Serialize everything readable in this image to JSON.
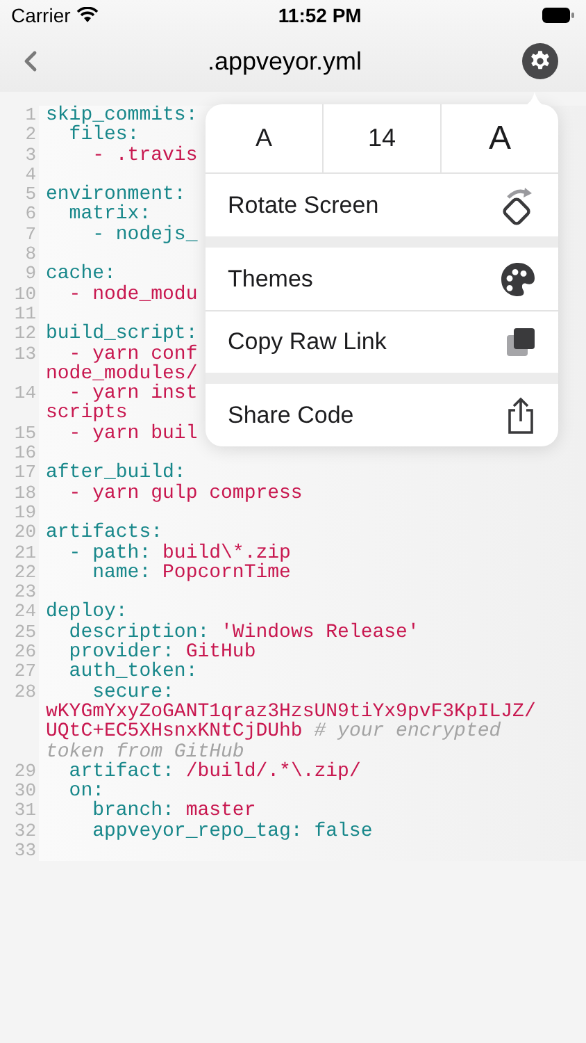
{
  "status_bar": {
    "carrier": "Carrier",
    "time": "11:52 PM"
  },
  "nav": {
    "title": ".appveyor.yml"
  },
  "code": [
    {
      "number": "1",
      "segments": [
        {
          "kind": "key",
          "text": "skip_commits:"
        }
      ]
    },
    {
      "number": "2",
      "segments": [
        {
          "kind": "key",
          "text": "  files:"
        }
      ]
    },
    {
      "number": "3",
      "segments": [
        {
          "kind": "value",
          "text": "    - .travis"
        }
      ]
    },
    {
      "number": "4"
    },
    {
      "number": "5",
      "segments": [
        {
          "kind": "key",
          "text": "environment:"
        }
      ]
    },
    {
      "number": "6",
      "segments": [
        {
          "kind": "key",
          "text": "  matrix:"
        }
      ]
    },
    {
      "number": "7",
      "segments": [
        {
          "kind": "key",
          "text": "    - nodejs_"
        }
      ]
    },
    {
      "number": "8"
    },
    {
      "number": "9",
      "segments": [
        {
          "kind": "key",
          "text": "cache:"
        }
      ]
    },
    {
      "number": "10",
      "segments": [
        {
          "kind": "value",
          "text": "  - node_modu"
        }
      ]
    },
    {
      "number": "11"
    },
    {
      "number": "12",
      "segments": [
        {
          "kind": "key",
          "text": "build_script:"
        }
      ]
    },
    {
      "number": "13",
      "segments": [
        {
          "kind": "value",
          "text": "  - yarn conf"
        }
      ]
    },
    {
      "segments": [
        {
          "kind": "value",
          "text": "node_modules/"
        }
      ]
    },
    {
      "number": "14",
      "segments": [
        {
          "kind": "value",
          "text": "  - yarn inst"
        }
      ]
    },
    {
      "segments": [
        {
          "kind": "value",
          "text": "scripts"
        }
      ]
    },
    {
      "number": "15",
      "segments": [
        {
          "kind": "value",
          "text": "  - yarn buil"
        }
      ]
    },
    {
      "number": "16"
    },
    {
      "number": "17",
      "segments": [
        {
          "kind": "key",
          "text": "after_build:"
        }
      ]
    },
    {
      "number": "18",
      "segments": [
        {
          "kind": "value",
          "text": "  - yarn gulp compress"
        }
      ]
    },
    {
      "number": "19"
    },
    {
      "number": "20",
      "segments": [
        {
          "kind": "key",
          "text": "artifacts:"
        }
      ]
    },
    {
      "number": "21",
      "segments": [
        {
          "kind": "key",
          "text": "  - path: "
        },
        {
          "kind": "value",
          "text": "build\\*.zip"
        }
      ]
    },
    {
      "number": "22",
      "segments": [
        {
          "kind": "key",
          "text": "    name: "
        },
        {
          "kind": "value",
          "text": "PopcornTime"
        }
      ]
    },
    {
      "number": "23"
    },
    {
      "number": "24",
      "segments": [
        {
          "kind": "key",
          "text": "deploy:"
        }
      ]
    },
    {
      "number": "25",
      "segments": [
        {
          "kind": "key",
          "text": "  description: "
        },
        {
          "kind": "value",
          "text": "'Windows Release'"
        }
      ]
    },
    {
      "number": "26",
      "segments": [
        {
          "kind": "key",
          "text": "  provider: "
        },
        {
          "kind": "value",
          "text": "GitHub"
        }
      ]
    },
    {
      "number": "27",
      "segments": [
        {
          "kind": "key",
          "text": "  auth_token:"
        }
      ]
    },
    {
      "number": "28",
      "segments": [
        {
          "kind": "key",
          "text": "    secure:"
        }
      ]
    },
    {
      "segments": [
        {
          "kind": "value",
          "text": "wKYGmYxyZoGANT1qraz3HzsUN9tiYx9pvF3KpILJZ/"
        }
      ]
    },
    {
      "segments": [
        {
          "kind": "value",
          "text": "UQtC+EC5XHsnxKNtCjDUhb "
        },
        {
          "kind": "comment",
          "text": "# your encrypted"
        }
      ]
    },
    {
      "segments": [
        {
          "kind": "comment",
          "text": "token from GitHub"
        }
      ]
    },
    {
      "number": "29",
      "segments": [
        {
          "kind": "key",
          "text": "  artifact: "
        },
        {
          "kind": "value",
          "text": "/build/.*\\.zip/"
        }
      ]
    },
    {
      "number": "30",
      "segments": [
        {
          "kind": "key",
          "text": "  on:"
        }
      ]
    },
    {
      "number": "31",
      "segments": [
        {
          "kind": "key",
          "text": "    branch: "
        },
        {
          "kind": "value",
          "text": "master"
        }
      ]
    },
    {
      "number": "32",
      "segments": [
        {
          "kind": "key",
          "text": "    appveyor_repo_tag: false"
        }
      ]
    },
    {
      "number": "33"
    }
  ],
  "menu": {
    "font_size": {
      "smaller": "A",
      "size": "14",
      "larger": "A"
    },
    "groups": [
      [
        {
          "kind": "rotate",
          "label": "Rotate Screen"
        }
      ],
      [
        {
          "kind": "themes",
          "label": "Themes"
        },
        {
          "kind": "copy",
          "label": "Copy Raw Link"
        }
      ],
      [
        {
          "kind": "share",
          "label": "Share Code"
        }
      ]
    ]
  }
}
